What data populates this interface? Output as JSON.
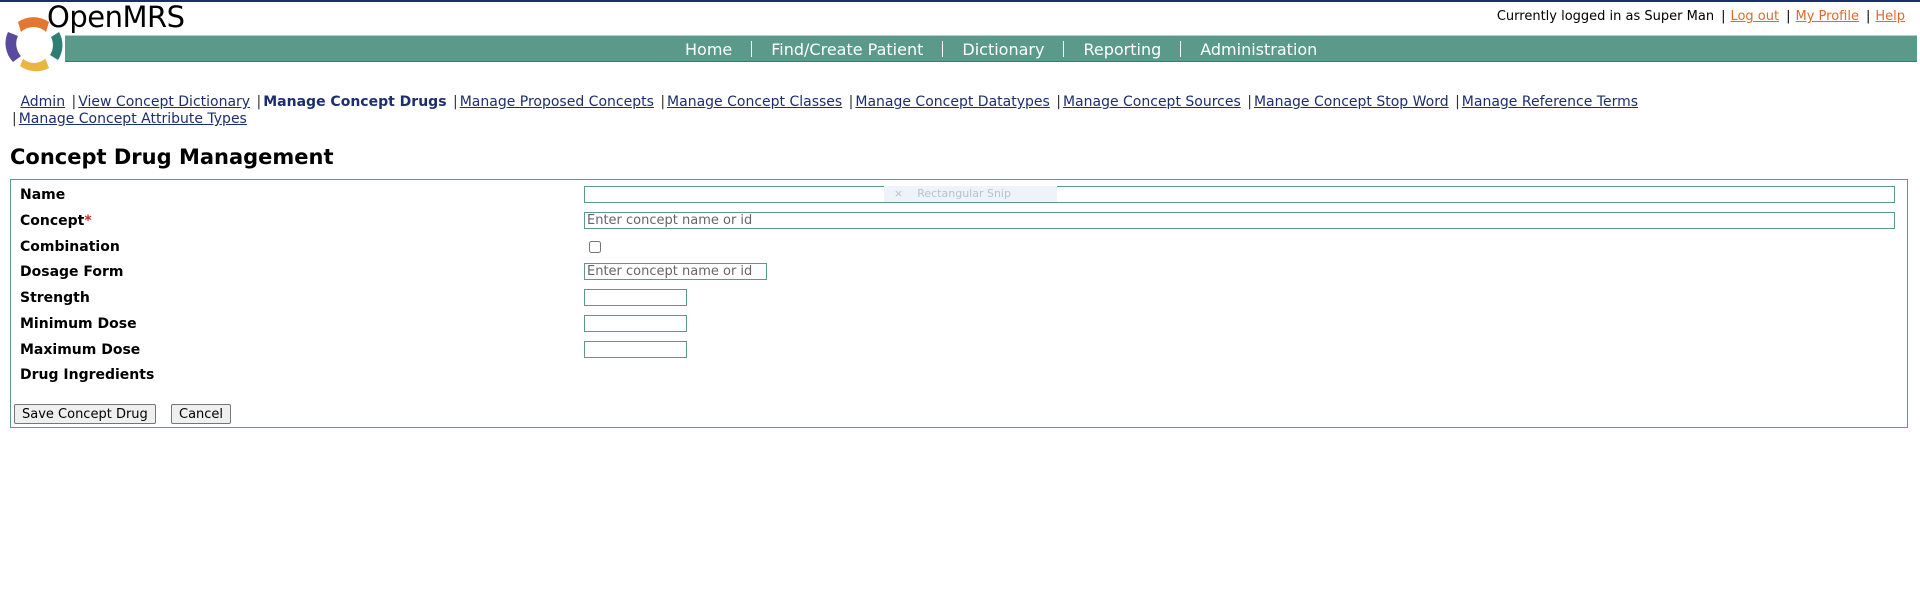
{
  "brand": {
    "name": "OpenMRS"
  },
  "userbar": {
    "logged_in_text": "Currently logged in as Super Man",
    "logout": "Log out",
    "my_profile": "My Profile",
    "help": "Help"
  },
  "nav": {
    "items": [
      "Home",
      "Find/Create Patient",
      "Dictionary",
      "Reporting",
      "Administration"
    ]
  },
  "subnav": {
    "items": [
      "Admin",
      "View Concept Dictionary",
      "Manage Concept Drugs",
      "Manage Proposed Concepts",
      "Manage Concept Classes",
      "Manage Concept Datatypes",
      "Manage Concept Sources",
      "Manage Concept Stop Word",
      "Manage Reference Terms",
      "Manage Concept Attribute Types"
    ],
    "current": "Manage Concept Drugs"
  },
  "page": {
    "title": "Concept Drug Management"
  },
  "form": {
    "labels": {
      "name": "Name",
      "concept": "Concept",
      "required_mark": "*",
      "combination": "Combination",
      "dosage_form": "Dosage Form",
      "strength": "Strength",
      "minimum_dose": "Minimum Dose",
      "maximum_dose": "Maximum Dose",
      "drug_ingredients": "Drug Ingredients"
    },
    "placeholders": {
      "concept": "Enter concept name or id",
      "dosage_form": "Enter concept name or id"
    },
    "values": {
      "name": "",
      "strength": "",
      "minimum_dose": "",
      "maximum_dose": ""
    },
    "buttons": {
      "save": "Save Concept Drug",
      "cancel": "Cancel"
    }
  },
  "overlay": {
    "snip_label": "Rectangular Snip",
    "snip_icon": "×"
  },
  "colors": {
    "nav_band": "#5b9a8a",
    "link_orange": "#e0692d",
    "link_navy": "#1d2e6e",
    "required": "#c0282d"
  }
}
